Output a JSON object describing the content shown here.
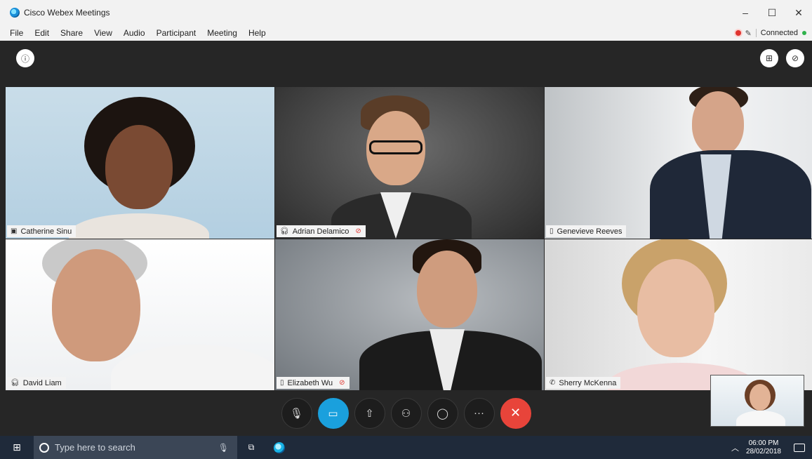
{
  "window": {
    "title": "Cisco Webex Meetings",
    "controls": [
      "–",
      "☐",
      "✕"
    ]
  },
  "menu": {
    "items": [
      "File",
      "Edit",
      "Share",
      "View",
      "Audio",
      "Participant",
      "Meeting",
      "Help"
    ],
    "status": "Connected"
  },
  "participants": [
    {
      "name": "Catherine Sinu",
      "device_icon": "video-device-icon",
      "muted": false,
      "active": true
    },
    {
      "name": "Adrian Delamico",
      "device_icon": "headset-icon",
      "muted": true,
      "active": false
    },
    {
      "name": "Genevieve Reeves",
      "device_icon": "mobile-icon",
      "muted": false,
      "active": false
    },
    {
      "name": "David Liam",
      "device_icon": "headset-icon",
      "muted": false,
      "active": false
    },
    {
      "name": "Elizabeth Wu",
      "device_icon": "mobile-icon",
      "muted": true,
      "active": false
    },
    {
      "name": "Sherry McKenna",
      "device_icon": "phone-icon",
      "muted": false,
      "active": false
    }
  ],
  "controls": [
    "microphone-muted-icon",
    "video-camera-icon",
    "share-upload-icon",
    "participants-icon",
    "chat-bubble-icon",
    "more-options-icon",
    "end-call-icon"
  ],
  "taskbar": {
    "search_placeholder": "Type here to search",
    "time": "06:00 PM",
    "date": "28/02/2018"
  },
  "colors": {
    "accent": "#1aa0dd",
    "end_call": "#e8443a",
    "recording": "#e0342f",
    "connected": "#2fb24c",
    "meeting_bg": "#262626"
  }
}
